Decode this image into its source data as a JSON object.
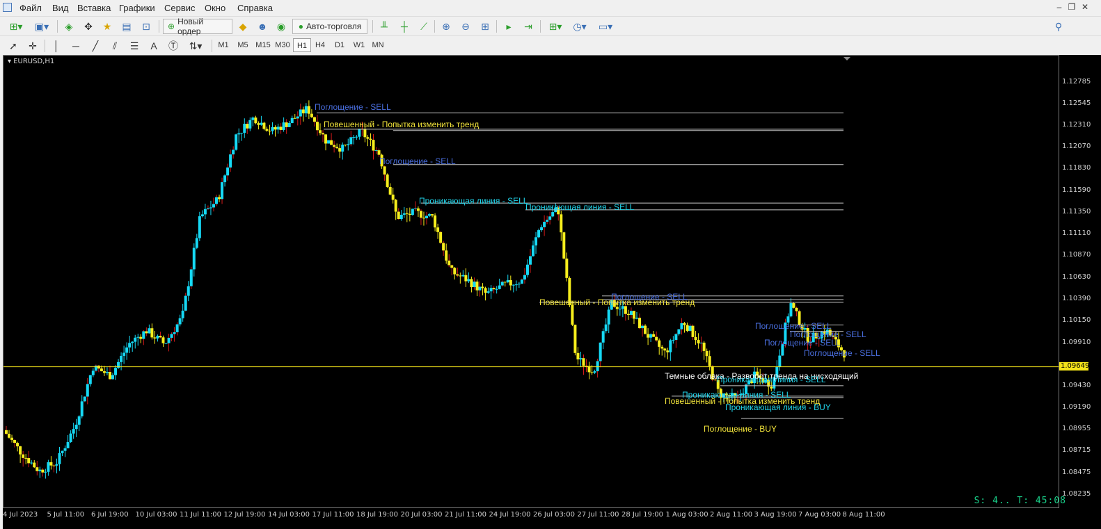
{
  "menu": [
    "Файл",
    "Вид",
    "Вставка",
    "Графики",
    "Сервис",
    "Окно",
    "Справка"
  ],
  "toolbar": {
    "new_order": "Новый ордер",
    "auto_trading": "Авто-торговля",
    "notifications_count": "1"
  },
  "timeframes": [
    "M1",
    "M5",
    "M15",
    "M30",
    "H1",
    "H4",
    "D1",
    "W1",
    "MN"
  ],
  "active_timeframe": "H1",
  "chart": {
    "symbol": "EURUSD,H1",
    "current_price": "1.09649",
    "timer": "S: 4.. T: 45:08"
  },
  "price_axis": [
    "1.12785",
    "1.12545",
    "1.12310",
    "1.12070",
    "1.11830",
    "1.11590",
    "1.11350",
    "1.11110",
    "1.10870",
    "1.10630",
    "1.10390",
    "1.10150",
    "1.09910",
    "1.09649",
    "1.09430",
    "1.09190",
    "1.08955",
    "1.08715",
    "1.08475",
    "1.08235"
  ],
  "time_axis": [
    "4 Jul 2023",
    "5 Jul 11:00",
    "6 Jul 19:00",
    "10 Jul 03:00",
    "11 Jul 11:00",
    "12 Jul 19:00",
    "14 Jul 03:00",
    "17 Jul 11:00",
    "18 Jul 19:00",
    "20 Jul 03:00",
    "21 Jul 11:00",
    "24 Jul 19:00",
    "26 Jul 03:00",
    "27 Jul 11:00",
    "28 Jul 19:00",
    "1 Aug 03:00",
    "2 Aug 11:00",
    "3 Aug 19:00",
    "7 Aug 03:00",
    "8 Aug 11:00"
  ],
  "colors": {
    "bull": "#16d9f5",
    "bear": "#f7ee1c",
    "wick_down": "#d21a1a",
    "sell_blue": "#4a6fe0",
    "sell_cyan": "#21d6ec",
    "yellow_label": "#f2e43a",
    "white_label": "#ffffff",
    "level_line": "#c8c8c8",
    "price_line": "#f5e51a"
  },
  "chart_data": {
    "type": "candlestick",
    "y_range": [
      1.0812,
      1.1289
    ],
    "current_price": 1.09649,
    "series": [
      {
        "name": "price",
        "values": [
          1.0895,
          1.087,
          1.085,
          1.086,
          1.09,
          1.0965,
          1.0955,
          1.099,
          1.1005,
          1.099,
          1.102,
          1.113,
          1.115,
          1.122,
          1.124,
          1.1225,
          1.1235,
          1.125,
          1.1215,
          1.1205,
          1.1225,
          1.12,
          1.113,
          1.1135,
          1.113,
          1.107,
          1.106,
          1.1045,
          1.1055,
          1.106,
          1.112,
          1.114,
          1.0975,
          1.096,
          1.1035,
          1.1025,
          1.1,
          1.098,
          1.1015,
          1.099,
          1.0935,
          1.093,
          1.0955,
          1.0945,
          1.1035,
          1.0995,
          1.1005,
          1.098
        ]
      }
    ]
  },
  "annotations": [
    {
      "text": "Поглощение - SELL",
      "color": "#4a6fe0"
    },
    {
      "text": "Повешенный - Попытка изменить тренд",
      "color": "#f2e43a"
    },
    {
      "text": "Поглощение - SELL",
      "color": "#4a6fe0"
    },
    {
      "text": "Проникающая линия - SELL",
      "color": "#21d6ec"
    },
    {
      "text": "Проникающая линия - SELL",
      "color": "#21d6ec"
    },
    {
      "text": "Поглощение - SELL",
      "color": "#4a6fe0"
    },
    {
      "text": "Повешенный - Попытка изменить тренд",
      "color": "#f2e43a"
    },
    {
      "text": "Поглощение - SELL",
      "color": "#4a6fe0"
    },
    {
      "text": "Поглощение - SELL",
      "color": "#4a6fe0"
    },
    {
      "text": "Поглощение - SELL",
      "color": "#4a6fe0"
    },
    {
      "text": "Поглощение - SELL",
      "color": "#4a6fe0"
    },
    {
      "text": "Темные облака - Разворот тренда на нисходящий",
      "color": "#ffffff"
    },
    {
      "text": "Проникающая линия - SELL",
      "color": "#21d6ec"
    },
    {
      "text": "Проникающая линия - SELL",
      "color": "#21d6ec"
    },
    {
      "text": "Повешенный - Попытка изменить тренд",
      "color": "#f2e43a"
    },
    {
      "text": "Проникающая линия - BUY",
      "color": "#21d6ec"
    },
    {
      "text": "Поглощение - BUY",
      "color": "#f2e43a"
    }
  ]
}
